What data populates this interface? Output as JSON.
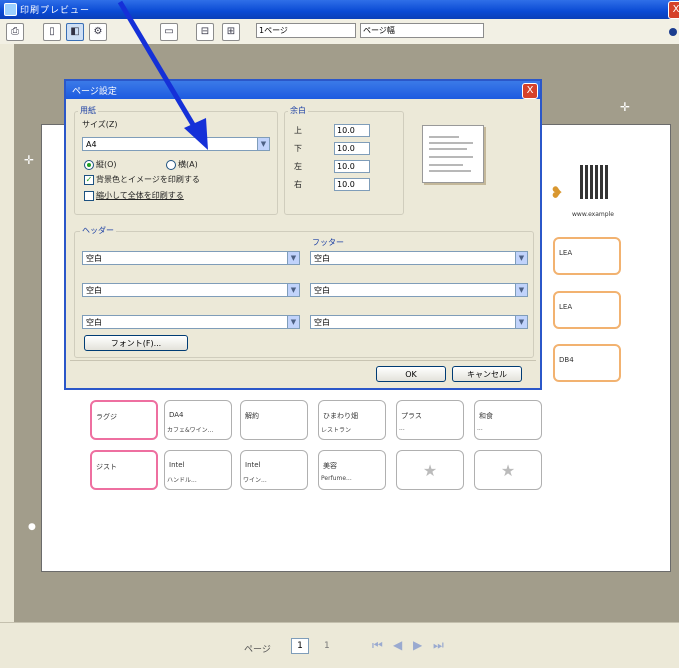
{
  "window": {
    "title": "印刷プレビュー",
    "close": "X"
  },
  "toolbar": {
    "buttons": [
      "print-icon",
      "page-single-icon",
      "page-double-icon",
      "page-multi-icon",
      "page-fit-icon",
      "zoom-out-icon",
      "zoom-in-icon"
    ],
    "page_size_value": "1ページ",
    "zoom_value": "ページ幅",
    "active_index": 2
  },
  "dialog": {
    "title": "ページ設定",
    "close": "X",
    "paper_group": "用紙",
    "paper_size_label": "サイズ(Z)",
    "paper_size_value": "A4",
    "orientation_portrait": "縦(O)",
    "orientation_landscape": "横(A)",
    "margin_group": "余白",
    "margin_top_label": "上",
    "margin_bottom_label": "下",
    "margin_left_label": "左",
    "margin_right_label": "右",
    "margin_top": "10.0",
    "margin_bottom": "10.0",
    "margin_left": "10.0",
    "margin_right": "10.0",
    "check1": "背景色とイメージを印刷する",
    "check2": "縮小して全体を印刷する",
    "header_group": "ヘッダー",
    "footer_group": "フッター",
    "header_selects": [
      "空白",
      "空白",
      "空白"
    ],
    "footer_selects": [
      "空白",
      "空白",
      "空白"
    ],
    "font_button": "フォント(F)...",
    "ok_button": "OK",
    "cancel_button": "キャンセル"
  },
  "preview": {
    "row1": [
      {
        "title": "ラグジ",
        "sub": "",
        "style": "pink"
      },
      {
        "title": "DA4",
        "sub": "カフェ&ワイン...",
        "style": ""
      },
      {
        "title": "解約",
        "sub": "",
        "style": ""
      },
      {
        "title": "ひまわり畑",
        "sub": "レストラン",
        "style": ""
      },
      {
        "title": "プラス",
        "sub": "...",
        "style": ""
      },
      {
        "title": "和食",
        "sub": "...",
        "style": ""
      },
      {
        "title": "DB4",
        "sub": "",
        "style": "orange"
      }
    ],
    "row2": [
      {
        "title": "ジスト",
        "sub": "",
        "style": "pink"
      },
      {
        "title": "Intel",
        "sub": "ハンドル...",
        "style": ""
      },
      {
        "title": "Intel",
        "sub": "ワイン...",
        "style": ""
      },
      {
        "title": "美容",
        "sub": "Perfume...",
        "style": ""
      },
      {
        "title": "",
        "sub": "",
        "style": "star"
      },
      {
        "title": "",
        "sub": "",
        "style": "star"
      },
      {
        "title": "",
        "sub": "",
        "style": "star"
      }
    ],
    "right_col": [
      "LEA",
      "LEA",
      "DB4"
    ],
    "qr_caption": "www.example"
  },
  "footer": {
    "page_label": "ページ",
    "page_value": "1",
    "page_total": "1"
  },
  "colors": {
    "arrow": "#1530d8",
    "titlebar": "#0a4ad4"
  }
}
